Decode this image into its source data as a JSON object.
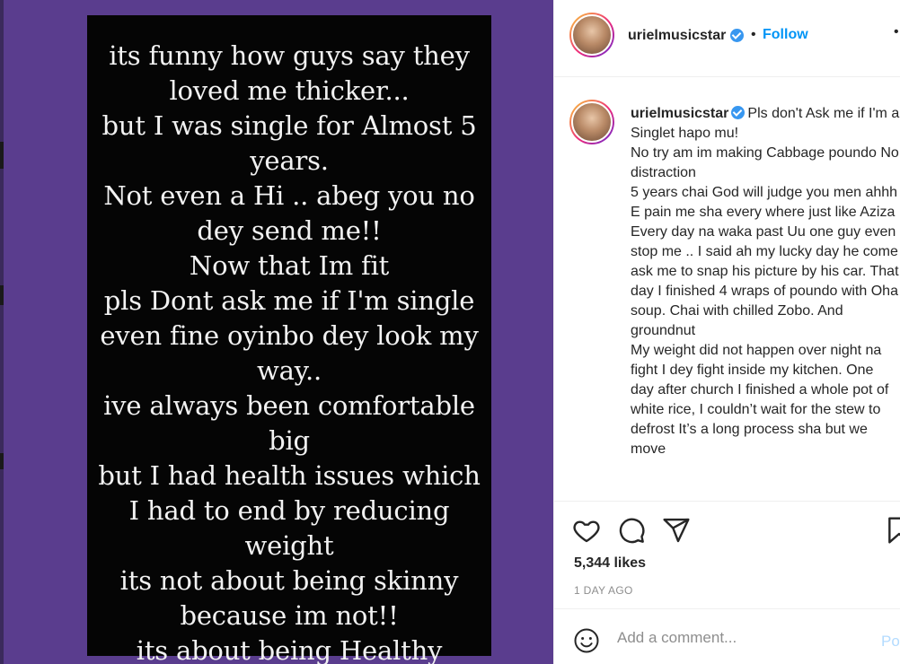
{
  "story": {
    "lines": [
      "its funny how guys say they",
      "loved me thicker...",
      "but I was single for Almost 5",
      "years.",
      "Not even a Hi .. abeg you no",
      "dey send me!!",
      "Now that Im fit",
      "pls Dont ask me if I'm single",
      "even fine oyinbo dey look my",
      "way..",
      "ive always been comfortable",
      "big",
      "but I had health issues which",
      "I had to end by reducing",
      "weight",
      "its not about being skinny",
      "because im not!!",
      "its about being Healthy"
    ]
  },
  "header": {
    "username": "urielmusicstar",
    "separator": "•",
    "follow_label": "Follow",
    "more_label": "•"
  },
  "caption": {
    "username": "urielmusicstar",
    "text": "Pls don't Ask me if I'm a Singlet hapo mu!\nNo try am im making Cabbage poundo No distraction\n5 years chai God will judge you men ahhh E pain me sha every where just like Aziza\nEvery day na waka past Uu one guy even stop me .. I said ah my lucky day he come ask me to snap his picture by his car. That day I finished 4 wraps of poundo with Oha soup. Chai with chilled Zobo. And groundnut\nMy weight did not happen over night na fight I dey fight inside my kitchen. One day after church I finished a whole pot of white rice, I couldn’t wait for the stew to defrost It’s a long process sha but we move"
  },
  "actions": {
    "icons": [
      "heart-icon",
      "comment-icon",
      "share-icon",
      "bookmark-icon"
    ],
    "likes": "5,344 likes",
    "time_ago": "1 DAY AGO"
  },
  "comment": {
    "placeholder": "Add a comment...",
    "post_label": "Po"
  },
  "colors": {
    "media_bg": "#5a3d8e",
    "story_bg": "#050505",
    "follow_blue": "#0095f6",
    "verified_blue": "#3897f0",
    "post_disabled": "#b3dbff"
  }
}
